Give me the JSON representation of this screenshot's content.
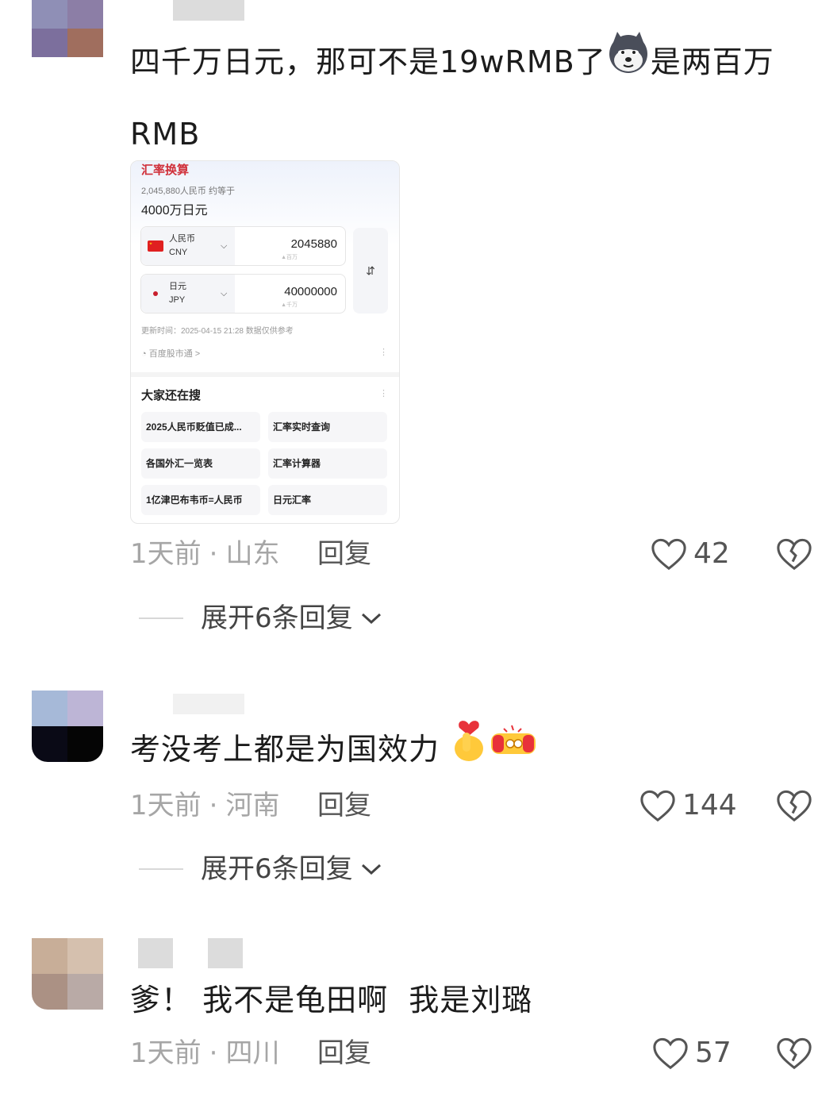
{
  "comments": [
    {
      "avatar_colors": [
        "#8f8fb6",
        "#8c7ea6",
        "#7c6f9d",
        "#a06e5e"
      ],
      "text": "四千万日元，那可不是19wRMB了",
      "text_after_emoji": "是两百万RMB",
      "emoji_icon": "husky-dog-icon",
      "meta": {
        "time": "1天前",
        "separator": "·",
        "location": "山东"
      },
      "reply_label": "回复",
      "like_count": "42",
      "expand_label": "展开6条回复"
    },
    {
      "avatar_colors": [
        "#a6b9d8",
        "#bdb5d6",
        "#0a0a16",
        "#050505"
      ],
      "text": "考没考上都是为国效力",
      "emoji_icons": [
        "finger-heart-icon",
        "fist-salute-icon"
      ],
      "meta": {
        "time": "1天前",
        "separator": "·",
        "location": "河南"
      },
      "reply_label": "回复",
      "like_count": "144",
      "expand_label": "展开6条回复"
    },
    {
      "avatar_colors": [
        "#c8ae98",
        "#d5c0ae",
        "#ab9184",
        "#b9aaa6"
      ],
      "text": "爹！ 我不是龟田啊  我是刘璐",
      "meta": {
        "time": "1天前",
        "separator": "·",
        "location": "四川"
      },
      "reply_label": "回复",
      "like_count": "57"
    }
  ],
  "embedded_card": {
    "title": "汇率换算",
    "summary_line": "2,045,880人民币 约等于",
    "result": "4000万日元",
    "from_currency": {
      "name": "人民币",
      "code": "CNY",
      "amount": "2045880",
      "hint": "▲百万",
      "flag": "cn-flag-icon"
    },
    "to_currency": {
      "name": "日元",
      "code": "JPY",
      "amount": "40000000",
      "hint": "▲千万",
      "flag": "jp-flag-icon"
    },
    "swap_icon": "⇵",
    "update_time": "更新时间：2025-04-15 21:28 数据仅供参考",
    "source": "百度股市通 >",
    "also_search_title": "大家还在搜",
    "also_search_items": [
      "2025人民币贬值已成...",
      "汇率实时查询",
      "各国外汇一览表",
      "汇率计算器",
      "1亿津巴布韦币=人民币",
      "日元汇率"
    ]
  },
  "colors": {
    "accent_red": "#d0303a",
    "meta_grey": "#a6a6a6"
  }
}
